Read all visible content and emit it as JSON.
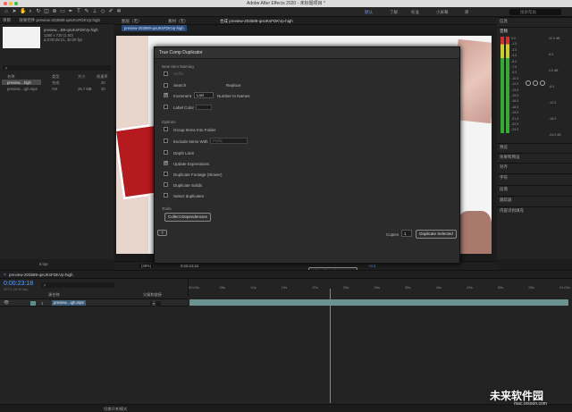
{
  "window": {
    "title": "Adobe After Effects 2020 - 未标题项目 *"
  },
  "workspaces": [
    "默认",
    "了解",
    "标准",
    "小屏幕",
    "库"
  ],
  "search": {
    "placeholder": "搜索帮助"
  },
  "project": {
    "tab": "项目",
    "effects_tab": "效果控件 preview-203589-qeUKsFDKVp-high",
    "item_name": "preview....B9-qeUKsFDKVp-high",
    "item_info1": "1280 x 720 (1.00)",
    "item_info2": "Δ 0:00:26:21, 30.00 fps",
    "search_placeholder": "ρ",
    "columns": {
      "name": "名称",
      "type": "类型",
      "size": "大小",
      "rate": "帧速率"
    },
    "rows": [
      {
        "name": "preview....high",
        "type": "合成",
        "size": "",
        "rate": "30"
      },
      {
        "name": "preview....igh.mp4",
        "type": "AVI",
        "size": "26.7 MB",
        "rate": "30"
      }
    ],
    "bpc": "8 bpc"
  },
  "viewer_tabs": {
    "layer": "图层（无）",
    "footage": "素材（无）",
    "comp": "合成 preview-203589-qeUKsFDKVp-high",
    "comp_sub": "preview-203589-qeUKsFDKVp-high"
  },
  "viewer_bottom": {
    "zoom": "(38%)",
    "timecode": "0:00:23:18",
    "exposure": "+0.0"
  },
  "dialog": {
    "title": "True Comp Duplicator",
    "section_naming": "New Item Naming",
    "suffix": "Suffix",
    "search": "Search",
    "replace": "Replace",
    "increment": "Increment",
    "last": "Last",
    "number_in_names": "Number In Names",
    "label_color": "Label Color",
    "section_options": "Options",
    "group_items": "Group Items Into Folder",
    "exclude_items": "Exclude Items With",
    "exclude_value": "Prefix",
    "depth_limit": "Depth Limit",
    "update_expressions": "Update Expressions",
    "duplicate_footage": "Duplicate Footage (Slower)",
    "duplicate_solids": "Duplicate Solids",
    "select_duplicates": "Select duplicates",
    "section_tools": "Tools",
    "collect_btn": "Collect Dependencies",
    "help_btn": "?",
    "copies_label": "Copies",
    "copies_value": "1",
    "duplicate_btn": "Duplicate Selected",
    "url_btn": "http://aescripts.com"
  },
  "right_panel": {
    "info": "信息",
    "audio": "音频",
    "db_left": [
      "0.0",
      "-1.5",
      "-3.0",
      "-4.5",
      "-6.0",
      "-7.5",
      "-9.0",
      "-10.5",
      "-12.0",
      "-13.5",
      "-15.0",
      "-16.5",
      "-18.0",
      "-19.5",
      "-21.0",
      "-22.5",
      "-24.0"
    ],
    "db_right": [
      "12.0 dB",
      "6.0",
      "0.0 dB",
      "-6.0",
      "-12.0",
      "-18.0",
      "-24.0 dB"
    ],
    "sections": [
      "预览",
      "效果和预设",
      "对齐",
      "字符",
      "段落",
      "跟踪器",
      "内容识别填充"
    ]
  },
  "timeline": {
    "tab": "preview-203589-qeUKsFDKVp-high",
    "timecode": "0:00:23:18",
    "timecode_sub": "00712 (30.00 fps)",
    "search_placeholder": "ρ",
    "col_source": "源名称",
    "col_parent": "父级和链接",
    "layer_num": "1",
    "layer_name": "preview....igh.mp4",
    "parent_value": "无",
    "ticks": [
      "00:00s",
      "05s",
      "10s",
      "15s",
      "20s",
      "25s",
      "30s",
      "35s",
      "40s",
      "45s",
      "50s",
      "55s",
      "01:00s"
    ],
    "playhead_fraction": 0.37
  },
  "status": {
    "toggle": "切换开关/模式"
  },
  "watermark": {
    "text": "未来软件园",
    "url": "mac.orsoon.com"
  }
}
